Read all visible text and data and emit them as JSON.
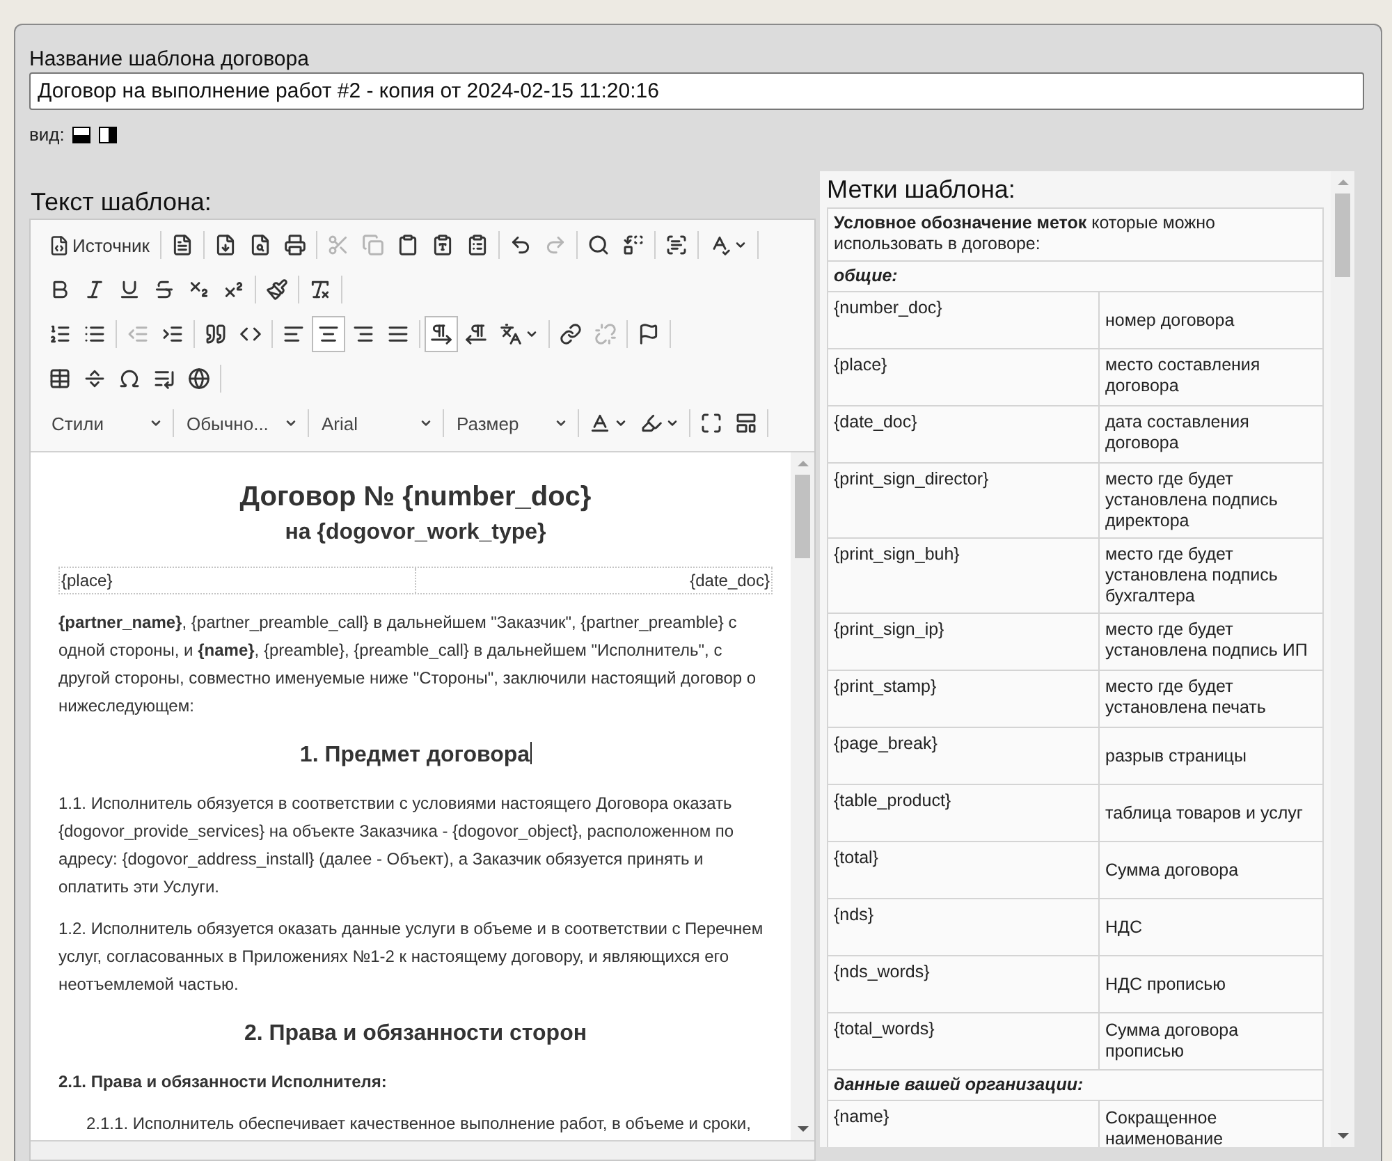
{
  "template_name": {
    "label": "Название шаблона договора",
    "value": "Договор на выполнение работ #2 - копия от 2024-02-15 11:20:16"
  },
  "view": {
    "label": "вид:"
  },
  "editor": {
    "title": "Текст шаблона:",
    "toolbar": [
      [
        [
          {
            "kind": "text",
            "label": "Источник",
            "disabled": false,
            "selected": false
          }
        ],
        [
          {
            "kind": "icon",
            "disabled": false,
            "selected": false
          }
        ],
        [
          {
            "kind": "icon",
            "disabled": false,
            "selected": false
          },
          {
            "kind": "icon",
            "disabled": false,
            "selected": false
          },
          {
            "kind": "icon",
            "disabled": false,
            "selected": false
          }
        ],
        [
          {
            "kind": "icon",
            "disabled": true,
            "selected": false
          },
          {
            "kind": "icon",
            "disabled": true,
            "selected": false
          },
          {
            "kind": "icon",
            "disabled": false,
            "selected": false
          },
          {
            "kind": "icon",
            "disabled": false,
            "selected": false
          },
          {
            "kind": "icon",
            "disabled": false,
            "selected": false
          }
        ],
        [
          {
            "kind": "icon",
            "disabled": false,
            "selected": false
          },
          {
            "kind": "icon",
            "disabled": true,
            "selected": false
          }
        ],
        [
          {
            "kind": "icon",
            "disabled": false,
            "selected": false
          },
          {
            "kind": "icon",
            "disabled": false,
            "selected": false
          }
        ],
        [
          {
            "kind": "icon",
            "disabled": false,
            "selected": false
          }
        ],
        [
          {
            "kind": "menu",
            "disabled": false,
            "selected": false
          }
        ]
      ],
      [
        [
          {
            "kind": "icon",
            "disabled": false,
            "selected": false
          },
          {
            "kind": "icon",
            "disabled": false,
            "selected": false
          },
          {
            "kind": "icon",
            "disabled": false,
            "selected": false
          },
          {
            "kind": "icon",
            "disabled": false,
            "selected": false
          },
          {
            "kind": "icon",
            "disabled": false,
            "selected": false
          },
          {
            "kind": "icon",
            "disabled": false,
            "selected": false
          }
        ],
        [
          {
            "kind": "icon",
            "disabled": false,
            "selected": false
          }
        ],
        [
          {
            "kind": "icon",
            "disabled": false,
            "selected": false
          }
        ]
      ],
      [
        [
          {
            "kind": "icon",
            "disabled": false,
            "selected": false
          },
          {
            "kind": "icon",
            "disabled": false,
            "selected": false
          }
        ],
        [
          {
            "kind": "icon",
            "disabled": true,
            "selected": false
          },
          {
            "kind": "icon",
            "disabled": false,
            "selected": false
          }
        ],
        [
          {
            "kind": "icon",
            "disabled": false,
            "selected": false
          },
          {
            "kind": "icon",
            "disabled": false,
            "selected": false
          }
        ],
        [
          {
            "kind": "icon",
            "disabled": false,
            "selected": false
          },
          {
            "kind": "icon",
            "disabled": false,
            "selected": true
          },
          {
            "kind": "icon",
            "disabled": false,
            "selected": false
          },
          {
            "kind": "icon",
            "disabled": false,
            "selected": false
          }
        ],
        [
          {
            "kind": "icon",
            "disabled": false,
            "selected": true
          },
          {
            "kind": "icon",
            "disabled": false,
            "selected": false
          },
          {
            "kind": "menu",
            "disabled": false,
            "selected": false
          }
        ],
        [
          {
            "kind": "icon",
            "disabled": false,
            "selected": false
          },
          {
            "kind": "icon",
            "disabled": true,
            "selected": false
          }
        ],
        [
          {
            "kind": "icon",
            "disabled": false,
            "selected": false
          }
        ]
      ],
      [
        [
          {
            "kind": "icon",
            "disabled": false,
            "selected": false
          },
          {
            "kind": "icon",
            "disabled": false,
            "selected": false
          },
          {
            "kind": "icon",
            "disabled": false,
            "selected": false
          },
          {
            "kind": "icon",
            "disabled": false,
            "selected": false
          },
          {
            "kind": "icon",
            "disabled": false,
            "selected": false
          }
        ]
      ],
      [
        [
          {
            "kind": "combo",
            "label": "Стили"
          }
        ],
        [
          {
            "kind": "combo",
            "label": "Обычно..."
          }
        ],
        [
          {
            "kind": "combo",
            "label": "Arial"
          }
        ],
        [
          {
            "kind": "combo",
            "label": "Размер"
          }
        ],
        [
          {
            "kind": "menu",
            "disabled": false,
            "selected": false
          },
          {
            "kind": "menu",
            "disabled": false,
            "selected": false
          }
        ],
        [
          {
            "kind": "icon",
            "disabled": false,
            "selected": false
          },
          {
            "kind": "icon",
            "disabled": false,
            "selected": false
          }
        ]
      ]
    ],
    "document": [
      {
        "kind": "title",
        "text": "Договор № {number_doc}"
      },
      {
        "kind": "subtitle",
        "text": "на {dogovor_work_type}"
      },
      {
        "kind": "place_row",
        "left": "{place}",
        "right": "{date_doc}"
      },
      {
        "kind": "paragraph",
        "text": "**{partner_name}**, {partner_preamble_call} в дальнейшем \"Заказчик\", {partner_preamble} с одной стороны, и **{name}**, {preamble}, {preamble_call} в дальнейшем \"Исполнитель\", с другой стороны, совместно именуемые ниже \"Стороны\", заключили настоящий договор о нижеследующем:"
      },
      {
        "kind": "heading",
        "text": "1. Предмет договора",
        "cursor": true
      },
      {
        "kind": "paragraph",
        "text": "1.1. Исполнитель обязуется в соответствии с условиями настоящего Договора оказать {dogovor_provide_services} на объекте Заказчика - {dogovor_object}, расположенном по адресу: {dogovor_address_install} (далее - Объект), а Заказчик обязуется принять и оплатить эти Услуги."
      },
      {
        "kind": "paragraph",
        "text": "1.2. Исполнитель обязуется оказать данные услуги в объеме и в соответствии с Перечнем услуг, согласованных в Приложениях №1-2 к настоящему договору, и являющихся его неотъемлемой частью."
      },
      {
        "kind": "heading",
        "text": "2. Права и обязанности сторон",
        "cursor": false
      },
      {
        "kind": "subheading",
        "text": "2.1. Права и обязанности Исполнителя:"
      },
      {
        "kind": "item",
        "text": "2.1.1. Исполнитель обеспечивает качественное выполнение работ, в объеме и сроки,"
      }
    ]
  },
  "tags": {
    "title": "Метки шаблона:",
    "rows": [
      {
        "kind": "intro",
        "text": "**Условное обозначение меток** которые можно использовать в договоре:"
      },
      {
        "kind": "section",
        "text": "общие:"
      },
      {
        "kind": "tag",
        "tag": "{number_doc}",
        "description": "номер договора"
      },
      {
        "kind": "tag",
        "tag": "{place}",
        "description": "место составления договора"
      },
      {
        "kind": "tag",
        "tag": "{date_doc}",
        "description": "дата составления договора"
      },
      {
        "kind": "tag",
        "tag": "{print_sign_director}",
        "description": "место где будет установлена подпись директора"
      },
      {
        "kind": "tag",
        "tag": "{print_sign_buh}",
        "description": "место где будет установлена подпись бухгалтера"
      },
      {
        "kind": "tag",
        "tag": "{print_sign_ip}",
        "description": "место где будет установлена подпись ИП"
      },
      {
        "kind": "tag",
        "tag": "{print_stamp}",
        "description": "место где будет установлена печать"
      },
      {
        "kind": "tag",
        "tag": "{page_break}",
        "description": "разрыв страницы"
      },
      {
        "kind": "tag",
        "tag": "{table_product}",
        "description": "таблица товаров и услуг"
      },
      {
        "kind": "tag",
        "tag": "{total}",
        "description": "Сумма договора"
      },
      {
        "kind": "tag",
        "tag": "{nds}",
        "description": "НДС"
      },
      {
        "kind": "tag",
        "tag": "{nds_words}",
        "description": "НДС прописью"
      },
      {
        "kind": "tag",
        "tag": "{total_words}",
        "description": "Сумма договора прописью"
      },
      {
        "kind": "section",
        "text": "данные вашей организации:"
      },
      {
        "kind": "tag",
        "tag": "{name}",
        "description": "Сокращенное наименование"
      }
    ]
  }
}
